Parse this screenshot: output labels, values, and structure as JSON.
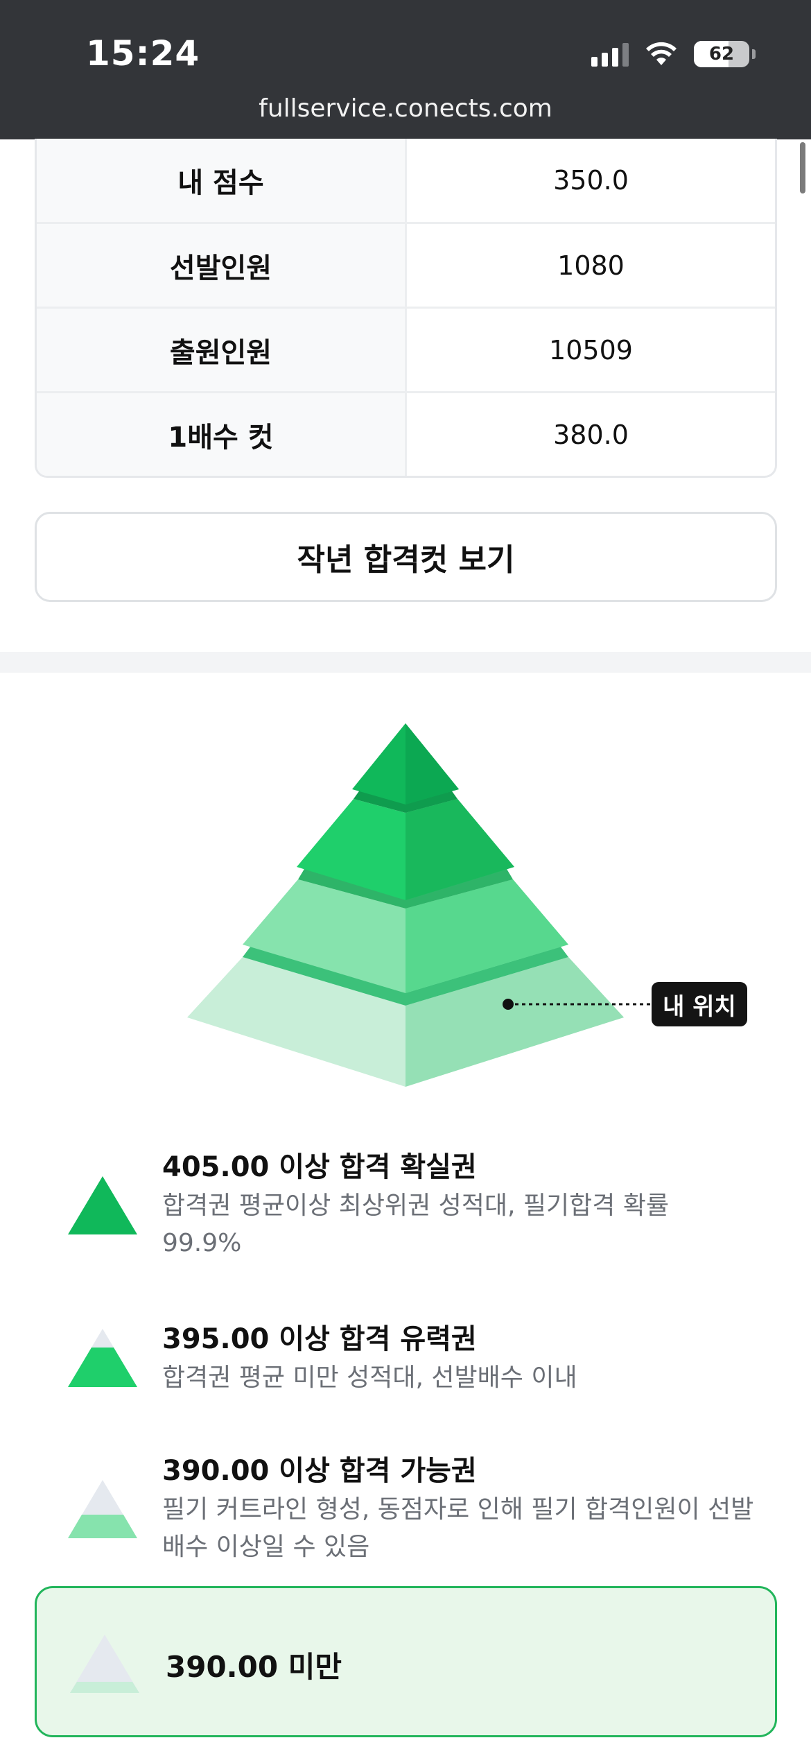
{
  "status_bar": {
    "time": "15:24",
    "battery_percent": "62",
    "battery_level": 0.62,
    "icons": [
      "cellular-signal-icon",
      "wifi-icon",
      "battery-icon"
    ]
  },
  "browser": {
    "url": "fullservice.conects.com"
  },
  "info_table": {
    "rows": [
      {
        "label": "내 점수",
        "value": "350.0"
      },
      {
        "label": "선발인원",
        "value": "1080"
      },
      {
        "label": "출원인원",
        "value": "10509"
      },
      {
        "label": "1배수 컷",
        "value": "380.0"
      }
    ]
  },
  "prev_cut_button": {
    "label": "작년 합격컷 보기"
  },
  "pyramid": {
    "my_position_label": "내 위치",
    "colors": {
      "tier1": "#10b85a",
      "tier2": "#1fcf6b",
      "tier3": "#86e3ad",
      "tier4": "#c8eed8"
    }
  },
  "legend": {
    "items": [
      {
        "title": "405.00 이상 합격 확실권",
        "desc_line1": "합격권 평균이상 최상위권 성적대, 필기합격 확률",
        "desc_line2": "99.9%"
      },
      {
        "title": "395.00 이상 합격 유력권",
        "desc_line1": "합격권 평균 미만 성적대, 선발배수 이내",
        "desc_line2": ""
      },
      {
        "title": "390.00 이상 합격 가능권",
        "desc_line1": "필기 커트라인 형성, 동점자로 인해 필기 합격인원이 선발",
        "desc_line2": "배수 이상일 수 있음"
      }
    ],
    "current": {
      "title": "390.00 미만"
    }
  }
}
